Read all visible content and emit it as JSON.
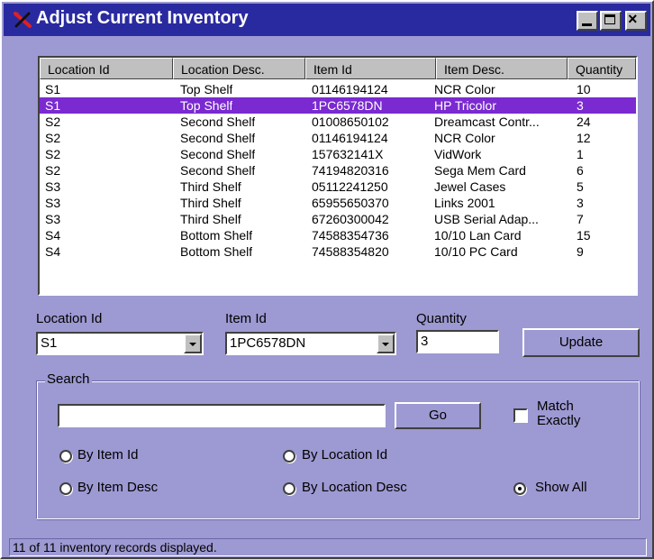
{
  "window": {
    "title": "Adjust Current Inventory",
    "title_color": "#2a2aa0",
    "body_color": "#9d99d2",
    "selection_color": "#7a2ad0"
  },
  "title_buttons": {
    "minimize_icon": "minimize-icon",
    "maximize_icon": "maximize-icon",
    "close_icon": "close-icon",
    "close_glyph": "×"
  },
  "list": {
    "columns": [
      "Location Id",
      "Location Desc.",
      "Item Id",
      "Item Desc.",
      "Quantity"
    ],
    "rows": [
      [
        "S1",
        "Top Shelf",
        "01146194124",
        "NCR Color",
        "10"
      ],
      [
        "S1",
        "Top Shelf",
        "1PC6578DN",
        "HP Tricolor",
        "3"
      ],
      [
        "S2",
        "Second Shelf",
        "01008650102",
        "Dreamcast Contr...",
        "24"
      ],
      [
        "S2",
        "Second Shelf",
        "01146194124",
        "NCR Color",
        "12"
      ],
      [
        "S2",
        "Second Shelf",
        "157632141X",
        "VidWork",
        "1"
      ],
      [
        "S2",
        "Second Shelf",
        "74194820316",
        "Sega Mem Card",
        "6"
      ],
      [
        "S3",
        "Third Shelf",
        "05112241250",
        "Jewel Cases",
        "5"
      ],
      [
        "S3",
        "Third Shelf",
        "65955650370",
        "Links 2001",
        "3"
      ],
      [
        "S3",
        "Third Shelf",
        "67260300042",
        "USB Serial Adap...",
        "7"
      ],
      [
        "S4",
        "Bottom Shelf",
        "74588354736",
        "10/10 Lan Card",
        "15"
      ],
      [
        "S4",
        "Bottom Shelf",
        "74588354820",
        "10/10 PC Card",
        "9"
      ]
    ],
    "selected_index": 1
  },
  "edit": {
    "location_label": "Location Id",
    "location_value": "S1",
    "item_label": "Item Id",
    "item_value": "1PC6578DN",
    "quantity_label": "Quantity",
    "quantity_value": "3",
    "update_label": "Update"
  },
  "search": {
    "group_label": "Search",
    "input_value": "",
    "go_label": "Go",
    "match_label_1": "Match",
    "match_label_2": "Exactly",
    "match_checked": false,
    "options": {
      "by_item_id": "By Item Id",
      "by_location_id": "By Location Id",
      "by_item_desc": "By Item Desc",
      "by_location_desc": "By Location Desc",
      "show_all": "Show All"
    },
    "selected_option": "show_all"
  },
  "status": {
    "text": "11 of 11 inventory records displayed."
  }
}
